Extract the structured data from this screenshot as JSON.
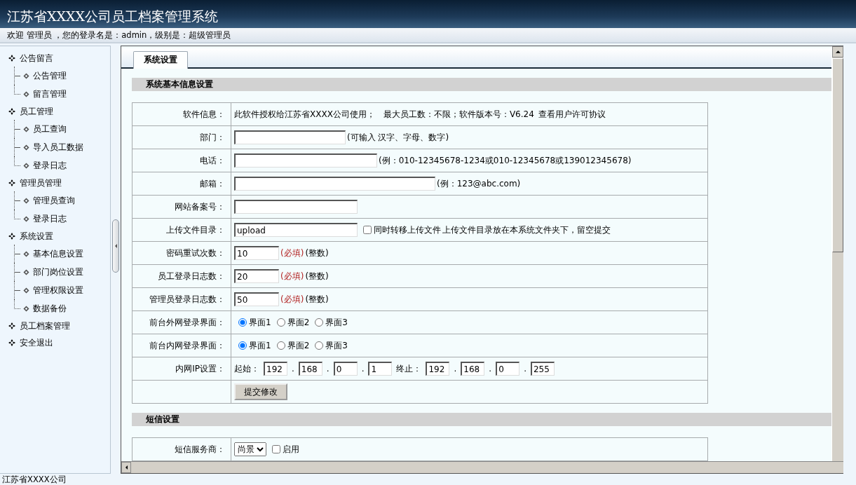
{
  "header": {
    "title": "江苏省XXXX公司员工档案管理系统",
    "welcome": "欢迎 管理员 ，您的登录名是：admin，级别是：超级管理员"
  },
  "sidebar": {
    "items": [
      {
        "label": "公告留言",
        "children": [
          {
            "label": "公告管理"
          },
          {
            "label": "留言管理"
          }
        ]
      },
      {
        "label": "员工管理",
        "children": [
          {
            "label": "员工查询"
          },
          {
            "label": "导入员工数据"
          },
          {
            "label": "登录日志"
          }
        ]
      },
      {
        "label": "管理员管理",
        "children": [
          {
            "label": "管理员查询"
          },
          {
            "label": "登录日志"
          }
        ]
      },
      {
        "label": "系统设置",
        "children": [
          {
            "label": "基本信息设置"
          },
          {
            "label": "部门岗位设置"
          },
          {
            "label": "管理权限设置"
          },
          {
            "label": "数据备份"
          }
        ]
      },
      {
        "label": "员工档案管理"
      },
      {
        "label": "安全退出"
      }
    ]
  },
  "tabs": [
    {
      "label": "系统设置",
      "selected": true
    }
  ],
  "sections": [
    {
      "title": "系统基本信息设置",
      "rows": [
        {
          "label": "软件信息：",
          "controls": [
            {
              "kind": "text",
              "text": "此软件授权给江苏省XXXX公司使用；　最大员工数：不限；软件版本号：V6.24"
            },
            {
              "kind": "link",
              "text": "查看用户许可协议"
            }
          ]
        },
        {
          "label": "部门：",
          "controls": [
            {
              "kind": "field"
            },
            {
              "kind": "note",
              "text": "(可输入 汉字、字母、数字)"
            }
          ]
        },
        {
          "label": "电话：",
          "controls": [
            {
              "kind": "field-l"
            },
            {
              "kind": "note",
              "text": "(例：010-12345678-1234或010-12345678或139012345678)"
            }
          ]
        },
        {
          "label": "邮箱：",
          "controls": [
            {
              "kind": "field-xl"
            },
            {
              "kind": "note",
              "text": "(例：123@abc.com)"
            }
          ]
        },
        {
          "label": "网站备案号：",
          "controls": [
            {
              "kind": "field-m"
            }
          ]
        },
        {
          "label": "上传文件目录：",
          "controls": [
            {
              "kind": "field-m",
              "value": "upload"
            },
            {
              "kind": "checkbox",
              "label": "同时转移上传文件",
              "checked": false
            },
            {
              "kind": "note",
              "text": "上传文件目录放在本系统文件夹下，留空提交"
            }
          ]
        },
        {
          "label": "密码重试次数：",
          "controls": [
            {
              "kind": "field-s",
              "value": "10"
            },
            {
              "kind": "required",
              "text": "(必填)"
            },
            {
              "kind": "note",
              "text": "(整数)"
            }
          ]
        },
        {
          "label": "员工登录日志数：",
          "controls": [
            {
              "kind": "field-s",
              "value": "20"
            },
            {
              "kind": "required",
              "text": "(必填)"
            },
            {
              "kind": "note",
              "text": "(整数)"
            }
          ]
        },
        {
          "label": "管理员登录日志数：",
          "controls": [
            {
              "kind": "field-s",
              "value": "50"
            },
            {
              "kind": "required",
              "text": "(必填)"
            },
            {
              "kind": "note",
              "text": "(整数)"
            }
          ]
        },
        {
          "label": "前台外网登录界面：",
          "controls": [
            {
              "kind": "radio",
              "label": "界面1",
              "selected": true
            },
            {
              "kind": "radio",
              "label": "界面2",
              "selected": false
            },
            {
              "kind": "radio",
              "label": "界面3",
              "selected": false
            }
          ]
        },
        {
          "label": "前台内网登录界面：",
          "controls": [
            {
              "kind": "radio",
              "label": "界面1",
              "selected": true
            },
            {
              "kind": "radio",
              "label": "界面2",
              "selected": false
            },
            {
              "kind": "radio",
              "label": "界面3",
              "selected": false
            }
          ]
        },
        {
          "label": "内网IP设置：",
          "controls": [
            {
              "kind": "note",
              "text": "起始："
            },
            {
              "kind": "field-ip",
              "value": "192"
            },
            {
              "kind": "note",
              "text": "."
            },
            {
              "kind": "field-ip",
              "value": "168"
            },
            {
              "kind": "note",
              "text": "."
            },
            {
              "kind": "field-ip",
              "value": "0"
            },
            {
              "kind": "note",
              "text": "."
            },
            {
              "kind": "field-ip",
              "value": "1"
            },
            {
              "kind": "note",
              "text": "终止："
            },
            {
              "kind": "field-ip",
              "value": "192"
            },
            {
              "kind": "note",
              "text": "."
            },
            {
              "kind": "field-ip",
              "value": "168"
            },
            {
              "kind": "note",
              "text": "."
            },
            {
              "kind": "field-ip",
              "value": "0"
            },
            {
              "kind": "note",
              "text": "."
            },
            {
              "kind": "field-ip",
              "value": "255"
            }
          ]
        },
        {
          "controls": [
            {
              "kind": "button",
              "text": "提交修改"
            }
          ]
        }
      ]
    },
    {
      "title": "短信设置",
      "rows": [
        {
          "label": "短信服务商：",
          "controls": [
            {
              "kind": "select",
              "value": "尚景"
            },
            {
              "kind": "checkbox",
              "label": "启用",
              "checked": false
            }
          ]
        }
      ]
    }
  ],
  "footer": "江苏省XXXX公司"
}
